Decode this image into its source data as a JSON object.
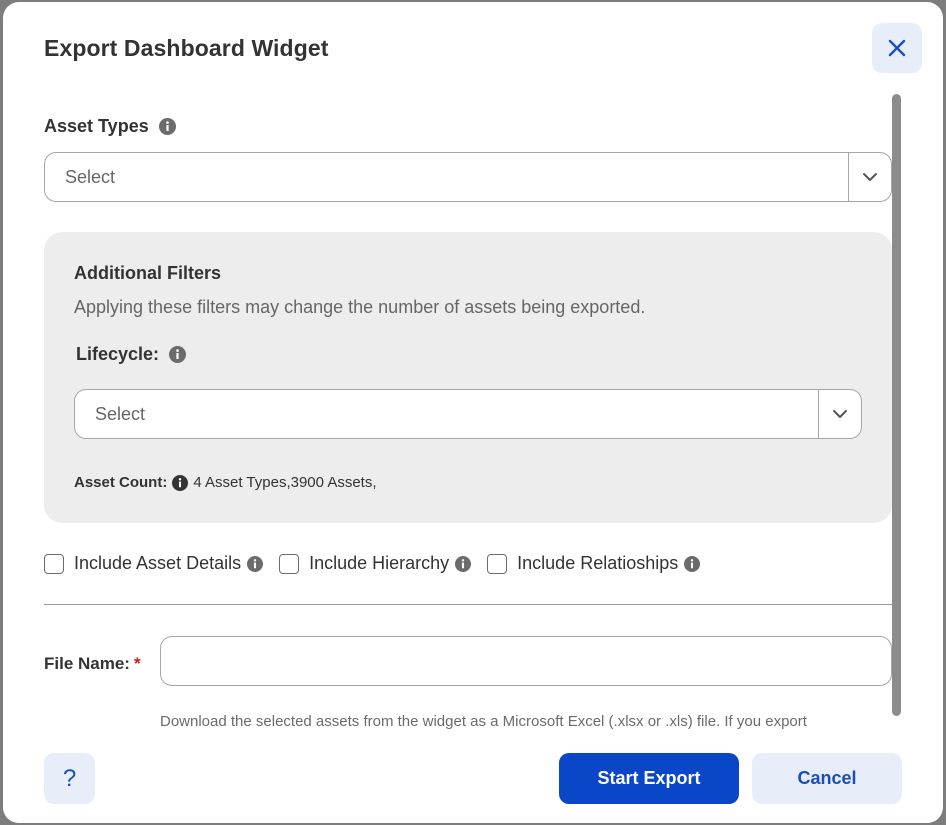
{
  "modal": {
    "title": "Export Dashboard Widget",
    "close_icon": "close-icon"
  },
  "asset_types": {
    "label": "Asset Types",
    "placeholder": "Select",
    "icon": "info-icon"
  },
  "filters": {
    "title": "Additional Filters",
    "description": "Applying these filters may change the number of assets being exported.",
    "lifecycle_label": "Lifecycle:",
    "lifecycle_placeholder": "Select",
    "asset_count_label": "Asset Count:",
    "asset_count_value": "4 Asset Types,3900 Assets,"
  },
  "options": {
    "include_details": "Include Asset Details",
    "include_hierarchy": "Include Hierarchy",
    "include_relationships": "Include Relatioships"
  },
  "file_name": {
    "label": "File Name:",
    "required_mark": "*",
    "value": "",
    "help_text": "Download the selected assets from the widget as a Microsoft Excel (.xlsx or .xls) file. If you export"
  },
  "footer": {
    "help_label": "?",
    "start_label": "Start Export",
    "cancel_label": "Cancel"
  },
  "colors": {
    "primary": "#0a47c8",
    "secondary_bg": "#e8eef9",
    "required": "#d01a1a"
  }
}
